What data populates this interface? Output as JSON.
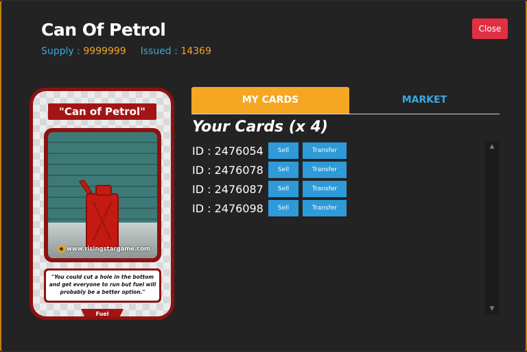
{
  "header": {
    "title": "Can Of Petrol",
    "supply_label": "Supply : ",
    "supply_value": "9999999",
    "issued_label": "Issued : ",
    "issued_value": "14369",
    "close_label": "Close"
  },
  "card": {
    "name": "\"Can of Petrol\"",
    "watermark": "www.risingstargame.com",
    "quote": "\"You could cut a hole in the bottom and get everyone to run but fuel will probably be a better option.\"",
    "type": "Fuel"
  },
  "tabs": [
    {
      "label": "MY CARDS",
      "active": true
    },
    {
      "label": "MARKET",
      "active": false
    }
  ],
  "owned": {
    "heading": "Your Cards (x 4)",
    "sell_label": "Sell",
    "transfer_label": "Transfer",
    "items": [
      {
        "id": "ID : 2476054"
      },
      {
        "id": "ID : 2476078"
      },
      {
        "id": "ID : 2476087"
      },
      {
        "id": "ID : 2476098"
      }
    ]
  },
  "colors": {
    "accent_orange": "#f5a623",
    "accent_blue": "#3aa7e0",
    "close_red": "#e03143",
    "card_red": "#8e1111"
  }
}
